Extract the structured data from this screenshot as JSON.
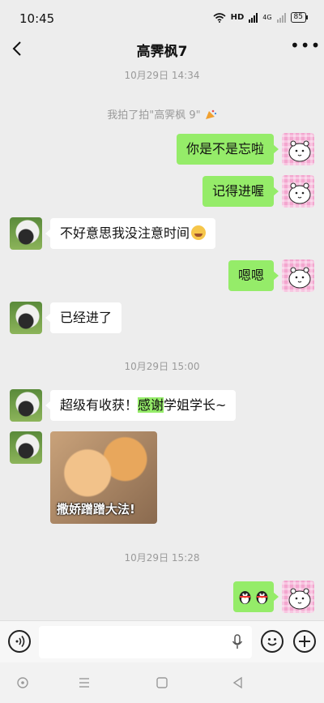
{
  "status_bar": {
    "time": "10:45",
    "network": "HD",
    "network_type": "4G",
    "battery": "85"
  },
  "header": {
    "title": "高霁枫7"
  },
  "messages": {
    "divider_1": "10月29日 14:34",
    "system_pat": "我拍了拍\"高霁枫 9\"",
    "m1": "你是不是忘啦",
    "m2": "记得进喔",
    "m3": "不好意思我没注意时间",
    "m4": "嗯嗯",
    "m5": "已经进了",
    "divider_2": "10月29日 15:00",
    "m6_a": "超级有收获！",
    "m6_hl": "感谢",
    "m6_b": "学姐学长~",
    "sticker_caption": "撒娇蹭蹭大法!",
    "divider_3": "10月29日 15:28"
  },
  "input": {
    "placeholder": ""
  },
  "colors": {
    "background": "#ededed",
    "my_bubble": "#95ec69",
    "their_bubble": "#ffffff"
  }
}
